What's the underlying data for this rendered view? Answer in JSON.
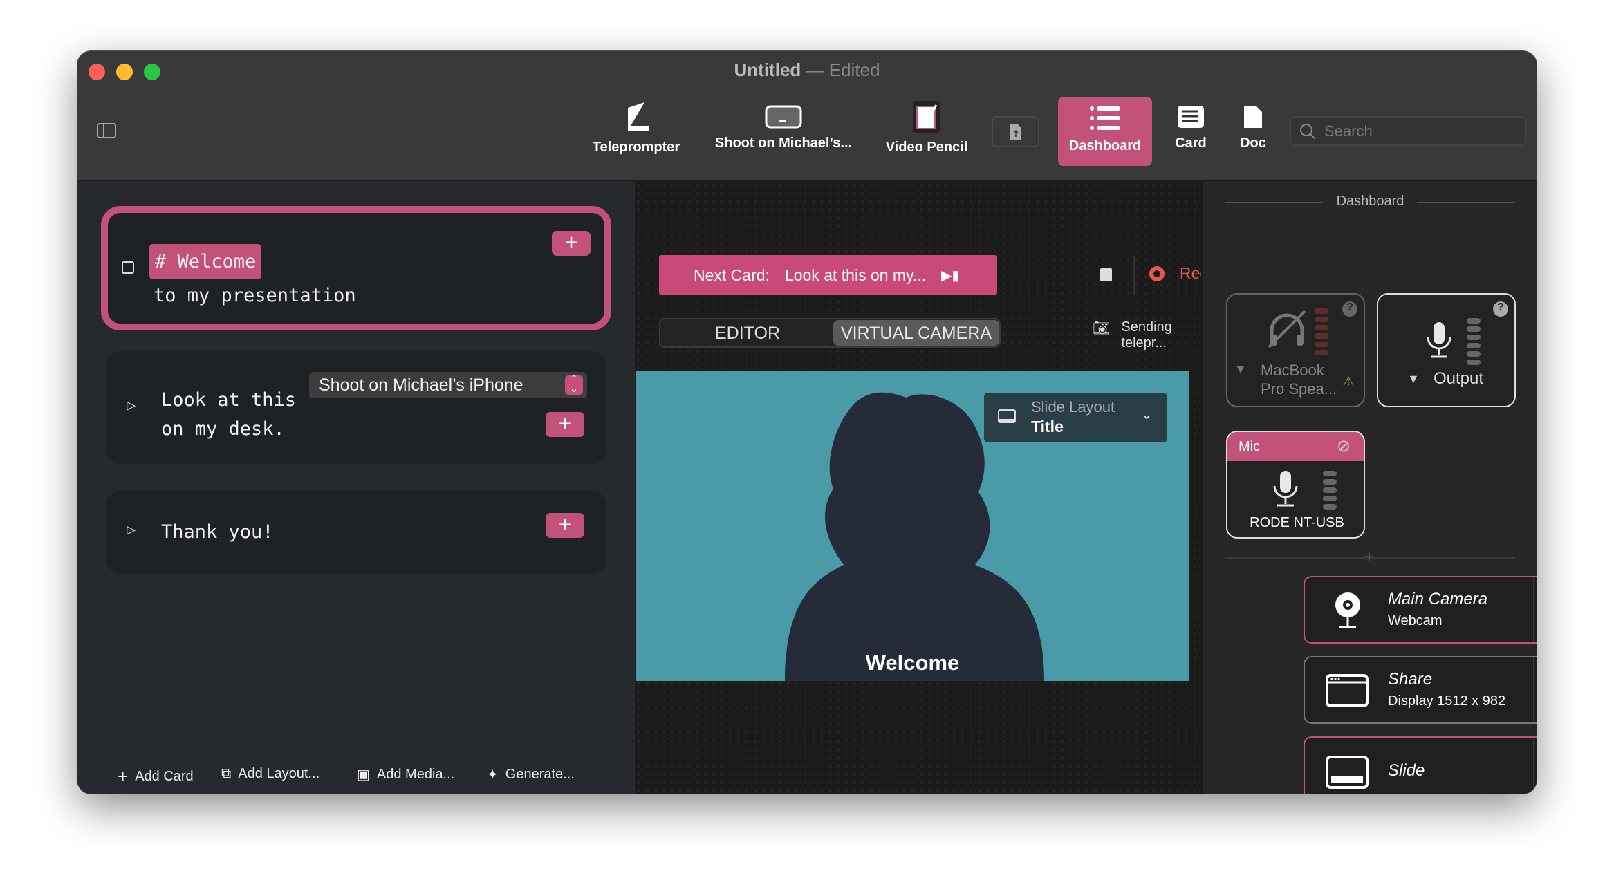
{
  "window": {
    "title": "Untitled",
    "edited": "— Edited"
  },
  "toolbar": {
    "teleprompter": "Teleprompter",
    "shoot": "Shoot on Michael’s...",
    "video_pencil": "Video Pencil",
    "dashboard": "Dashboard",
    "card": "Card",
    "doc": "Doc",
    "search_placeholder": "Search"
  },
  "cards": [
    {
      "heading": "# Welcome",
      "line2": "to my presentation"
    },
    {
      "line1": "Look at this",
      "line2": "on my desk.",
      "device": "Shoot on Michael’s iPhone"
    },
    {
      "line1": "Thank you!"
    }
  ],
  "left_bottom": {
    "add_card": "Add Card",
    "add_layout": "Add Layout...",
    "add_media": "Add Media...",
    "generate": "Generate..."
  },
  "center": {
    "next_card_label": "Next Card:",
    "next_card_value": "Look at this on my...",
    "record": "Record",
    "tab_editor": "EDITOR",
    "tab_virtual_camera": "VIRTUAL CAMERA",
    "status": "Sending telepr...",
    "slide_layout_label": "Slide Layout",
    "slide_layout_value": "Title",
    "preview_text": "Welcome"
  },
  "right": {
    "header": "Dashboard",
    "speaker": {
      "name": "MacBook Pro Spea..."
    },
    "output": {
      "name": "Output"
    },
    "mic": {
      "label": "Mic",
      "name": "RODE NT-USB"
    },
    "sources": [
      {
        "name": "Main Camera",
        "sub": "Webcam"
      },
      {
        "name": "Share",
        "sub": "Display 1512 x 982"
      },
      {
        "name": "Slide",
        "sub": ""
      }
    ]
  },
  "colors": {
    "accent": "#c2527a",
    "record": "#e8574a",
    "preview_bg": "#4a9aa8"
  }
}
